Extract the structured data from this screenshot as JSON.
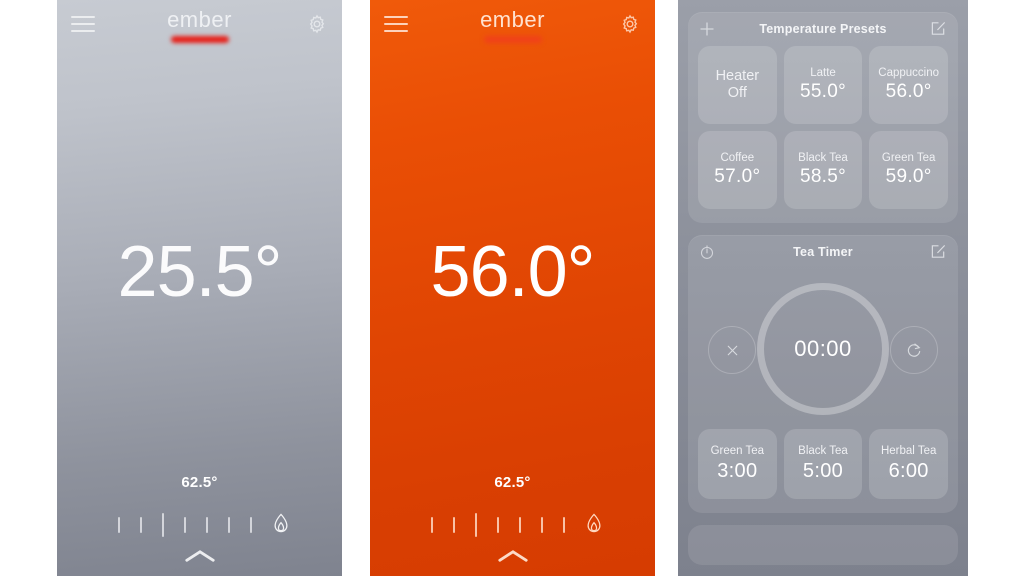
{
  "device_panel_current": {
    "brand": "ember",
    "menu_icon": "hamburger-icon",
    "settings_icon": "gear-icon",
    "current_temperature": "25.5°",
    "target_temperature": "62.5°",
    "heat_icon": "flame-icon",
    "expand_icon": "chevron-up-icon",
    "ticks": 7,
    "background_color": "#a8acb6"
  },
  "device_panel_heating": {
    "brand": "ember",
    "menu_icon": "hamburger-icon",
    "settings_icon": "gear-icon",
    "current_temperature": "56.0°",
    "target_temperature": "62.5°",
    "heat_icon": "flame-icon",
    "expand_icon": "chevron-up-icon",
    "ticks": 7,
    "background_color": "#e04503"
  },
  "presets_panel": {
    "temperature_presets": {
      "title": "Temperature Presets",
      "add_icon": "plus-icon",
      "edit_icon": "edit-square-icon",
      "items": [
        {
          "label": "Heater\nOff",
          "value": "",
          "off": true
        },
        {
          "label": "Latte",
          "value": "55.0°",
          "off": false
        },
        {
          "label": "Cappuccino",
          "value": "56.0°",
          "off": false
        },
        {
          "label": "Coffee",
          "value": "57.0°",
          "off": false
        },
        {
          "label": "Black Tea",
          "value": "58.5°",
          "off": false
        },
        {
          "label": "Green Tea",
          "value": "59.0°",
          "off": false
        }
      ]
    },
    "tea_timer": {
      "title": "Tea Timer",
      "clock_icon": "stopwatch-icon",
      "edit_icon": "edit-square-icon",
      "display": "00:00",
      "cancel_icon": "close-icon",
      "restart_icon": "refresh-icon",
      "presets": [
        {
          "label": "Green Tea",
          "value": "3:00"
        },
        {
          "label": "Black Tea",
          "value": "5:00"
        },
        {
          "label": "Herbal Tea",
          "value": "6:00"
        }
      ]
    }
  },
  "colors": {
    "accent_red": "#e61f18",
    "orange": "#e04503",
    "grey": "#a8acb6"
  }
}
